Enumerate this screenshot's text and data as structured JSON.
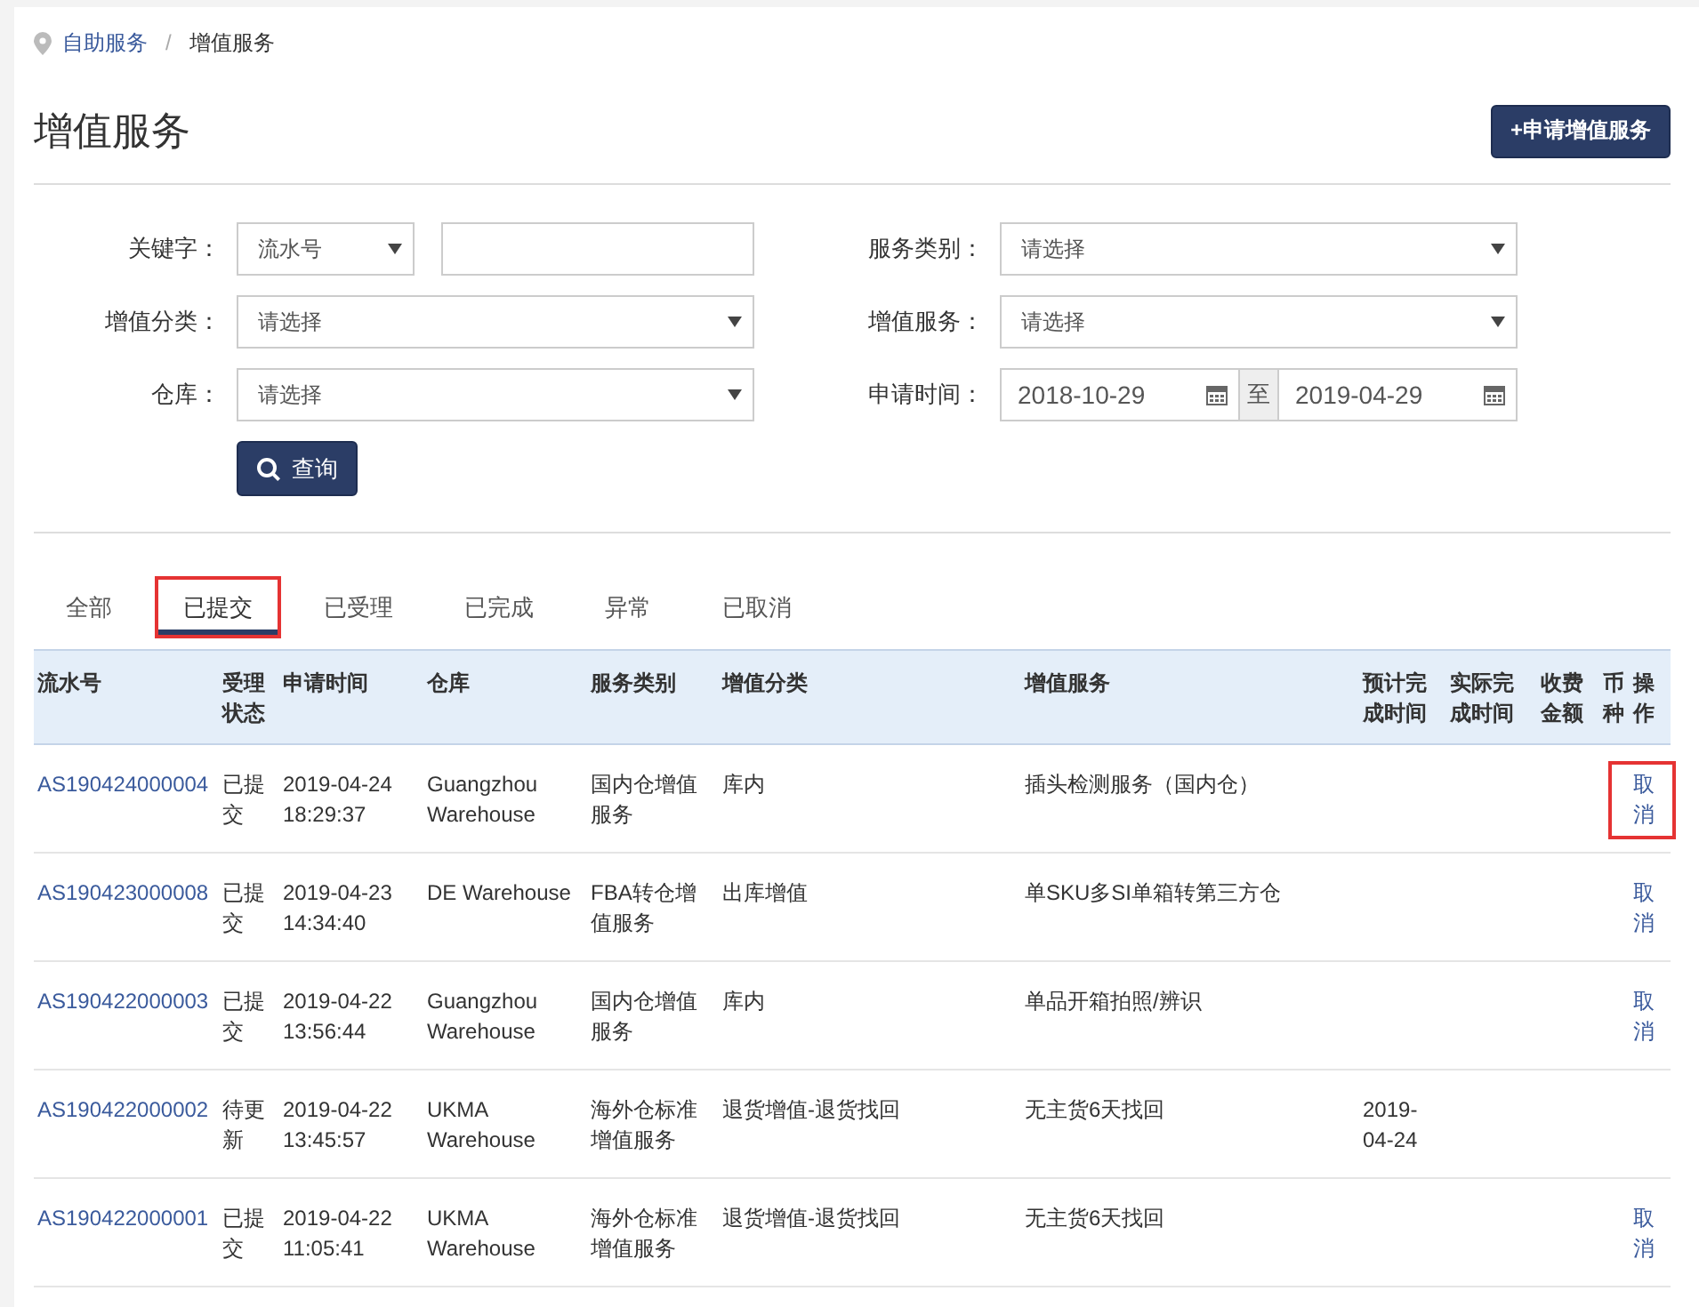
{
  "breadcrumb": [
    {
      "label": "自助服务",
      "link": true
    },
    {
      "label": "增值服务",
      "link": false
    }
  ],
  "breadcrumb_separator": "/",
  "title": "增值服务",
  "apply_button": "+申请增值服务",
  "filters": {
    "keyword": {
      "label": "关键字：",
      "type_value": "流水号"
    },
    "service_type": {
      "label": "服务类别：",
      "placeholder": "请选择"
    },
    "category": {
      "label": "增值分类：",
      "placeholder": "请选择"
    },
    "service": {
      "label": "增值服务：",
      "placeholder": "请选择"
    },
    "warehouse": {
      "label": "仓库：",
      "placeholder": "请选择"
    },
    "date": {
      "label": "申请时间：",
      "from": "2018-10-29",
      "separator": "至",
      "to": "2019-04-29"
    },
    "search_button": "查询"
  },
  "tabs": [
    {
      "label": "全部",
      "selected": false,
      "highlighted": false
    },
    {
      "label": "已提交",
      "selected": true,
      "highlighted": true
    },
    {
      "label": "已受理",
      "selected": false,
      "highlighted": false
    },
    {
      "label": "已完成",
      "selected": false,
      "highlighted": false
    },
    {
      "label": "异常",
      "selected": false,
      "highlighted": false
    },
    {
      "label": "已取消",
      "selected": false,
      "highlighted": false
    }
  ],
  "table": {
    "columns": [
      "流水号",
      "受理状态",
      "申请时间",
      "仓库",
      "服务类别",
      "增值分类",
      "增值服务",
      "预计完成时间",
      "实际完成时间",
      "收费金额",
      "币种",
      "操作"
    ],
    "rows": [
      {
        "id": "AS190424000004",
        "status": "已提交",
        "time": "2019-04-24 18:29:37",
        "warehouse": "Guangzhou Warehouse",
        "type": "国内仓增值服务",
        "category": "库内",
        "service": "插头检测服务（国内仓）",
        "expected": "",
        "actual": "",
        "fee": "",
        "currency": "",
        "action": "取消",
        "action_highlighted": true
      },
      {
        "id": "AS190423000008",
        "status": "已提交",
        "time": "2019-04-23 14:34:40",
        "warehouse": "DE Warehouse",
        "type": "FBA转仓增值服务",
        "category": "出库增值",
        "service": "单SKU多SI单箱转第三方仓",
        "expected": "",
        "actual": "",
        "fee": "",
        "currency": "",
        "action": "取消",
        "action_highlighted": false
      },
      {
        "id": "AS190422000003",
        "status": "已提交",
        "time": "2019-04-22 13:56:44",
        "warehouse": "Guangzhou Warehouse",
        "type": "国内仓增值服务",
        "category": "库内",
        "service": "单品开箱拍照/辨识",
        "expected": "",
        "actual": "",
        "fee": "",
        "currency": "",
        "action": "取消",
        "action_highlighted": false
      },
      {
        "id": "AS190422000002",
        "status": "待更新",
        "time": "2019-04-22 13:45:57",
        "warehouse": "UKMA Warehouse",
        "type": "海外仓标准增值服务",
        "category": "退货增值-退货找回",
        "service": "无主货6天找回",
        "expected": "2019-04-24",
        "actual": "",
        "fee": "",
        "currency": ""
      },
      {
        "id": "AS190422000001",
        "status": "已提交",
        "time": "2019-04-22 11:05:41",
        "warehouse": "UKMA Warehouse",
        "type": "海外仓标准增值服务",
        "category": "退货增值-退货找回",
        "service": "无主货6天找回",
        "expected": "",
        "actual": "",
        "fee": "",
        "currency": "",
        "action": "取消",
        "action_highlighted": false
      }
    ]
  }
}
